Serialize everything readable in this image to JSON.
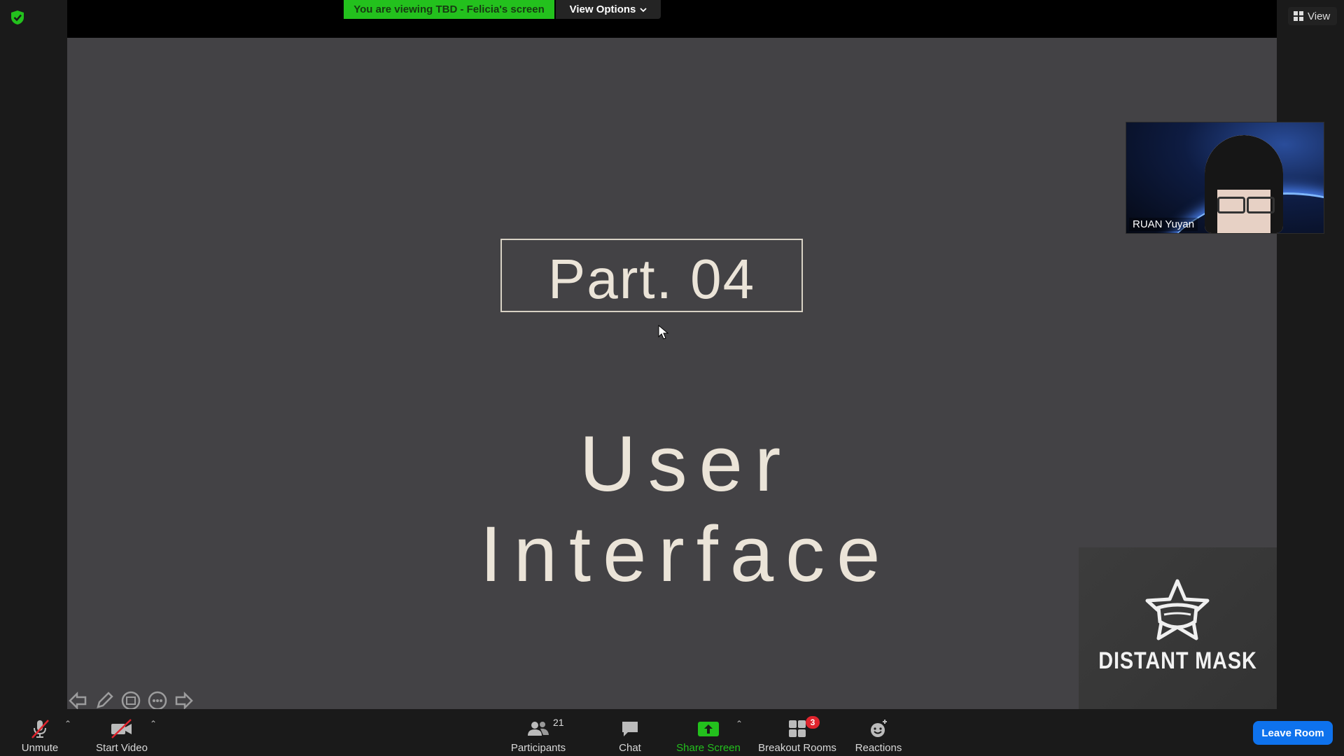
{
  "banner": {
    "viewing_text": "You are viewing TBD - Felicia's screen",
    "view_options_label": "View Options",
    "color": "#23c11d"
  },
  "header": {
    "view_label": "View"
  },
  "slide": {
    "part_label": "Part. 04",
    "title": "User Interface",
    "background": "#434245"
  },
  "participant_video": {
    "name": "RUAN Yuyan"
  },
  "logo": {
    "text": "DISTANT MASK"
  },
  "toolbar": {
    "unmute_label": "Unmute",
    "start_video_label": "Start Video",
    "participants_label": "Participants",
    "participants_count": "21",
    "chat_label": "Chat",
    "share_screen_label": "Share Screen",
    "breakout_rooms_label": "Breakout Rooms",
    "breakout_badge": "3",
    "reactions_label": "Reactions",
    "leave_label": "Leave Room",
    "leave_color": "#0e72ed"
  },
  "icons": [
    "shield-icon",
    "view-grid-icon",
    "chevron-down-icon",
    "mouse-cursor-icon",
    "star-mask-logo-icon",
    "arrow-left-icon",
    "pencil-icon",
    "stamp-icon",
    "more-icon",
    "arrow-right-icon",
    "muted-mic-icon",
    "video-off-icon",
    "participants-icon",
    "chat-icon",
    "share-screen-icon",
    "breakout-rooms-icon",
    "reactions-icon",
    "caret-up-icon"
  ]
}
